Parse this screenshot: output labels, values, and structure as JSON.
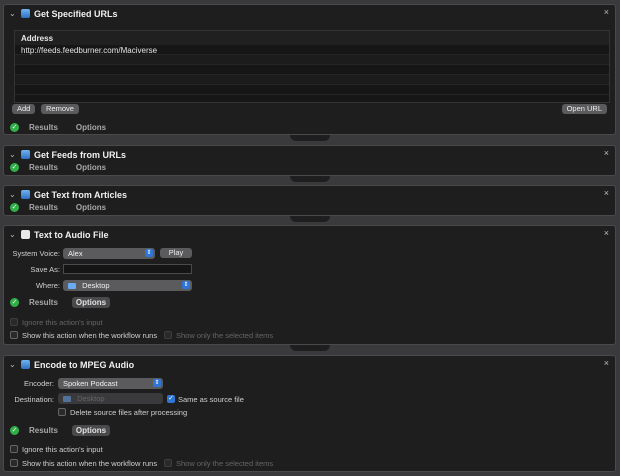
{
  "actions": {
    "urls": {
      "title": "Get Specified URLs",
      "column": "Address",
      "address": "http://feeds.feedburner.com/Maciverse",
      "add": "Add",
      "remove": "Remove",
      "open": "Open URL",
      "results": "Results",
      "options": "Options"
    },
    "feeds": {
      "title": "Get Feeds from URLs",
      "results": "Results",
      "options": "Options"
    },
    "text": {
      "title": "Get Text from Articles",
      "results": "Results",
      "options": "Options"
    },
    "audio": {
      "title": "Text to Audio File",
      "voice_label": "System Voice:",
      "voice_value": "Alex",
      "play": "Play",
      "saveas_label": "Save As:",
      "saveas_value": "",
      "where_label": "Where:",
      "where_value": "Desktop",
      "results": "Results",
      "options": "Options",
      "ignore": "Ignore this action's input",
      "show_runs": "Show this action when the workflow runs",
      "show_selected": "Show only the selected items"
    },
    "mpeg": {
      "title": "Encode to MPEG Audio",
      "encoder_label": "Encoder:",
      "encoder_value": "Spoken Podcast",
      "dest_label": "Destination:",
      "dest_value": "Desktop",
      "same_source": "Same as source file",
      "delete_source": "Delete source files after processing",
      "results": "Results",
      "options": "Options",
      "ignore": "Ignore this action's input",
      "show_runs": "Show this action when the workflow runs",
      "show_selected": "Show only the selected items"
    }
  },
  "icons": {
    "close": "×",
    "chevron": "⌄",
    "check": "✓",
    "arrows": "⇕"
  }
}
